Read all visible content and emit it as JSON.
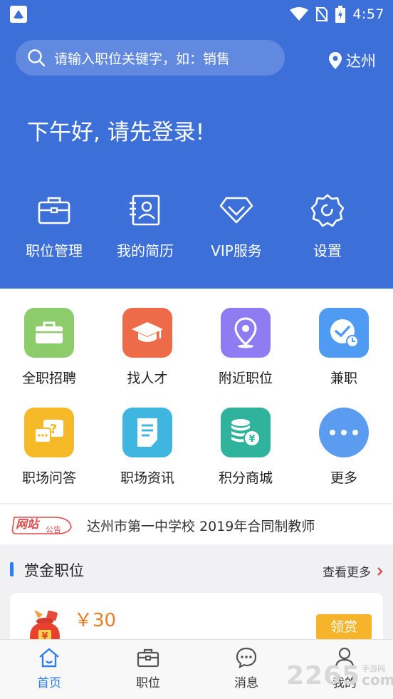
{
  "status_bar": {
    "time": "4:57"
  },
  "search": {
    "placeholder": "请输入职位关键字，如：销售"
  },
  "location": {
    "city": "达州"
  },
  "greeting": "下午好, 请先登录!",
  "quick_actions": [
    {
      "label": "职位管理",
      "icon": "briefcase-icon"
    },
    {
      "label": "我的简历",
      "icon": "resume-icon"
    },
    {
      "label": "VIP服务",
      "icon": "diamond-icon"
    },
    {
      "label": "设置",
      "icon": "gear-icon"
    }
  ],
  "categories": [
    {
      "label": "全职招聘",
      "icon": "suitcase-icon",
      "color": "#8dcc6a"
    },
    {
      "label": "找人才",
      "icon": "graduation-cap-icon",
      "color": "#ee6b4a"
    },
    {
      "label": "附近职位",
      "icon": "map-pin-icon",
      "color": "#8f7bf2"
    },
    {
      "label": "兼职",
      "icon": "clock-check-icon",
      "color": "#4f9af3"
    },
    {
      "label": "职场问答",
      "icon": "chat-question-icon",
      "color": "#f6b927"
    },
    {
      "label": "职场资讯",
      "icon": "document-icon",
      "color": "#3fb6df"
    },
    {
      "label": "积分商城",
      "icon": "coin-stack-icon",
      "color": "#2fb39d"
    },
    {
      "label": "更多",
      "icon": "more-dots-icon",
      "color": "#5b9cf0"
    }
  ],
  "notice": {
    "badge_main": "网站",
    "badge_sub": "公告",
    "text": "达州市第一中学校 2019年合同制教师"
  },
  "bounty": {
    "title": "赏金职位",
    "more_label": "查看更多",
    "card": {
      "price": "￥30",
      "button_label": "领赏"
    }
  },
  "bottom_nav": [
    {
      "label": "首页",
      "icon": "home-icon",
      "active": true
    },
    {
      "label": "职位",
      "icon": "briefcase-icon",
      "active": false
    },
    {
      "label": "消息",
      "icon": "message-icon",
      "active": false
    },
    {
      "label": "我的",
      "icon": "user-icon",
      "active": false
    }
  ],
  "watermark": {
    "number": "2265",
    "site": "手游网",
    "domain": "com"
  },
  "colors": {
    "header_blue": "#3d6fd8",
    "accent_blue": "#2d7ef0",
    "price_orange": "#f07b25",
    "button_yellow": "#f6b42a"
  }
}
